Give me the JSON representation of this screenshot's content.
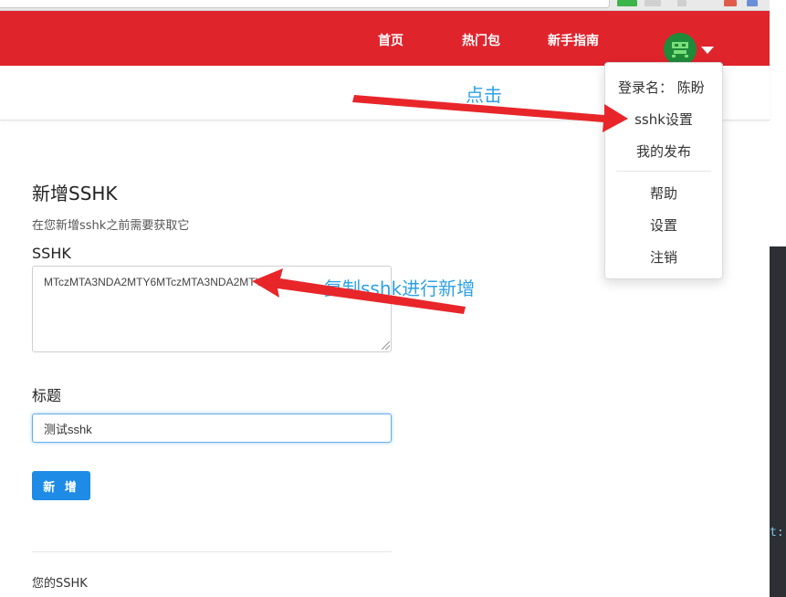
{
  "nav": {
    "links": [
      "首页",
      "热门包",
      "新手指南"
    ]
  },
  "dropdown": {
    "login_label": "登录名：",
    "login_name": "陈盼",
    "items": [
      "sshk设置",
      "我的发布",
      "帮助",
      "设置",
      "注销"
    ]
  },
  "form": {
    "title": "新增SSHK",
    "description": "在您新增sshk之前需要获取它",
    "sshk_label": "SSHK",
    "sshk_value": "MTczMTA3NDA2MTY6MTczMTA3NDA2MTY=",
    "title_label": "标题",
    "title_value": "测试sshk",
    "submit_label": "新 增",
    "list_heading": "您的SSHK"
  },
  "annotations": {
    "click_note": "点击",
    "copy_note": "复制sshk进行新增"
  },
  "side_panel": {
    "code_fragment": "t:"
  },
  "colors": {
    "navbar": "#e0242c",
    "primary_button": "#1e8ce6",
    "annotation_text": "#2da1e6",
    "arrow": "#e8262a"
  },
  "icons": {
    "avatar": "green-robot-avatar-icon",
    "caret": "caret-down-icon"
  }
}
